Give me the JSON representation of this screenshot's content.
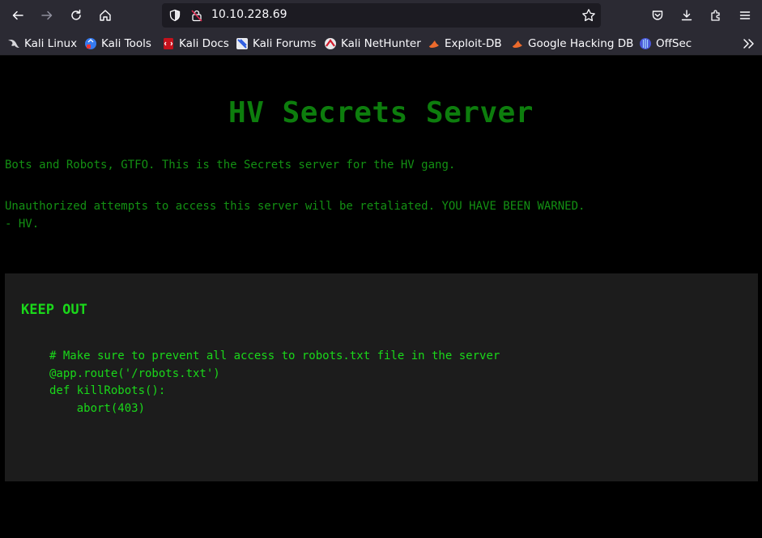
{
  "browser": {
    "url": "10.10.228.69",
    "bookmarks": [
      {
        "label": "Kali Linux",
        "icon": "kali-dragon-icon"
      },
      {
        "label": "Kali Tools",
        "icon": "kali-tools-icon"
      },
      {
        "label": "Kali Docs",
        "icon": "kali-docs-icon"
      },
      {
        "label": "Kali Forums",
        "icon": "kali-forums-icon"
      },
      {
        "label": "Kali NetHunter",
        "icon": "kali-nethunter-icon"
      },
      {
        "label": "Exploit-DB",
        "icon": "exploit-db-icon"
      },
      {
        "label": "Google Hacking DB",
        "icon": "ghdb-icon"
      },
      {
        "label": "OffSec",
        "icon": "offsec-icon"
      }
    ]
  },
  "page": {
    "title": "HV Secrets Server",
    "intro": "Bots and Robots, GTFO. This is the Secrets server for the HV gang.",
    "warning_line1": "Unauthorized attempts to access this server will be retaliated. YOU HAVE BEEN WARNED.",
    "warning_line2": "- HV.",
    "panel": {
      "heading": "KEEP OUT",
      "code": "# Make sure to prevent all access to robots.txt file in the server\n@app.route('/robots.txt')\ndef killRobots():\n    abort(403)"
    }
  },
  "colors": {
    "title": "#0d7d0d",
    "text": "#139013",
    "code": "#1ad81a",
    "panel_bg": "#1c1c1c",
    "chrome_bg": "#2b2a33"
  }
}
